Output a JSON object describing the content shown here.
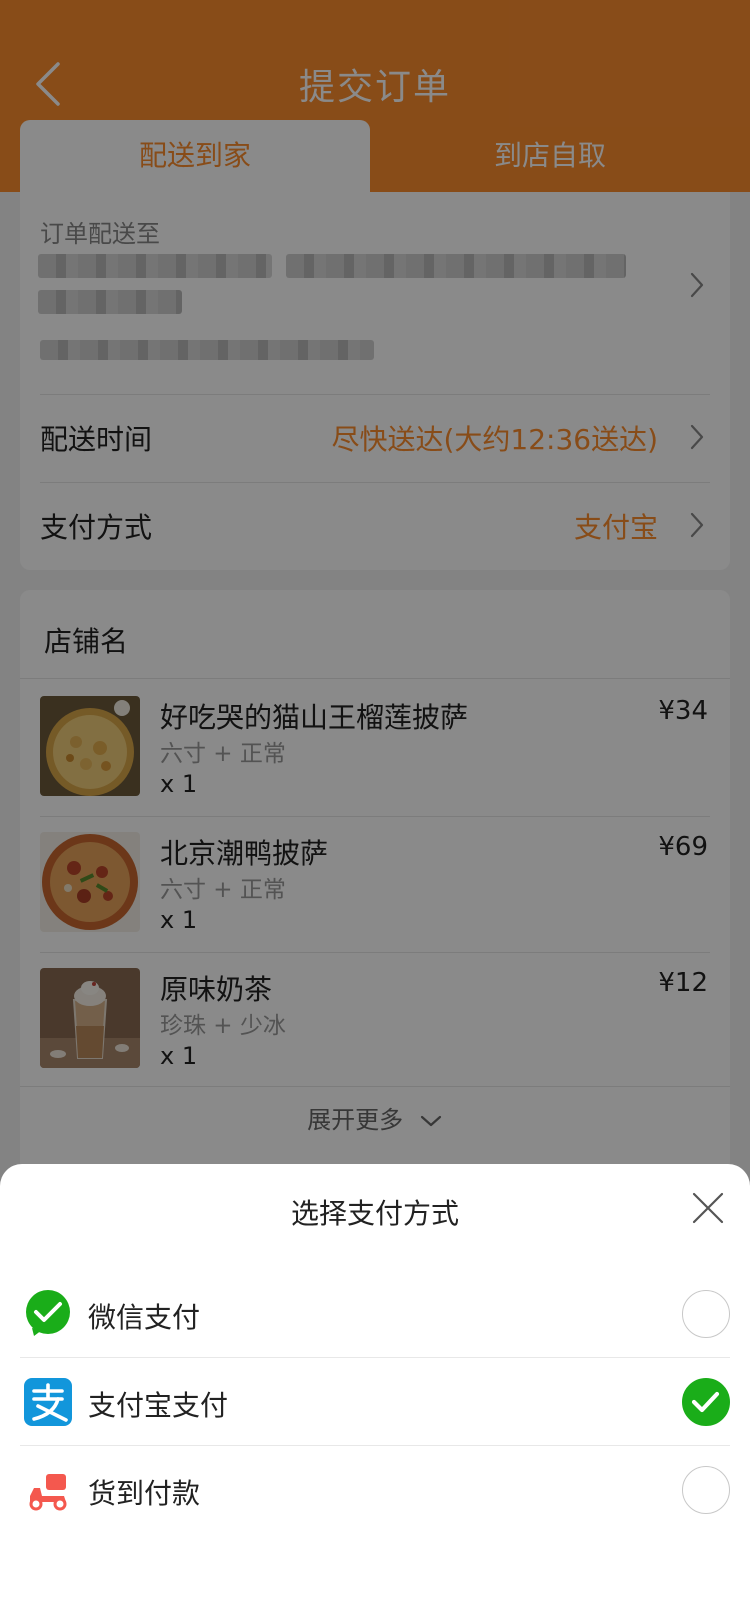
{
  "page": {
    "title": "提交订单",
    "tabs": [
      {
        "label": "配送到家",
        "active": true
      },
      {
        "label": "到店自取",
        "active": false
      }
    ]
  },
  "address": {
    "label": "订单配送至"
  },
  "delivery": {
    "label": "配送时间",
    "value": "尽快送达(大约12:36送达)"
  },
  "payment": {
    "label": "支付方式",
    "value": "支付宝"
  },
  "shop": {
    "name": "店铺名",
    "items": [
      {
        "name": "好吃哭的猫山王榴莲披萨",
        "spec": "六寸 + 正常",
        "qty": "x 1",
        "price": "¥34",
        "thumb": "pizza-durian-image"
      },
      {
        "name": "北京潮鸭披萨",
        "spec": "六寸 + 正常",
        "qty": "x 1",
        "price": "¥69",
        "thumb": "pizza-duck-image"
      },
      {
        "name": "原味奶茶",
        "spec": "珍珠 + 少冰",
        "qty": "x 1",
        "price": "¥12",
        "thumb": "milk-tea-image"
      }
    ],
    "expand_label": "展开更多"
  },
  "sheet": {
    "title": "选择支付方式",
    "options": [
      {
        "label": "微信支付",
        "icon": "wechat-icon",
        "selected": false
      },
      {
        "label": "支付宝支付",
        "icon": "alipay-icon",
        "selected": true
      },
      {
        "label": "货到付款",
        "icon": "delivery-scooter-icon",
        "selected": false
      }
    ]
  },
  "colors": {
    "accent": "#fb8c2e",
    "wechat": "#1aad19",
    "alipay": "#1296db",
    "cod": "#f4584e",
    "check": "#1aad19"
  }
}
